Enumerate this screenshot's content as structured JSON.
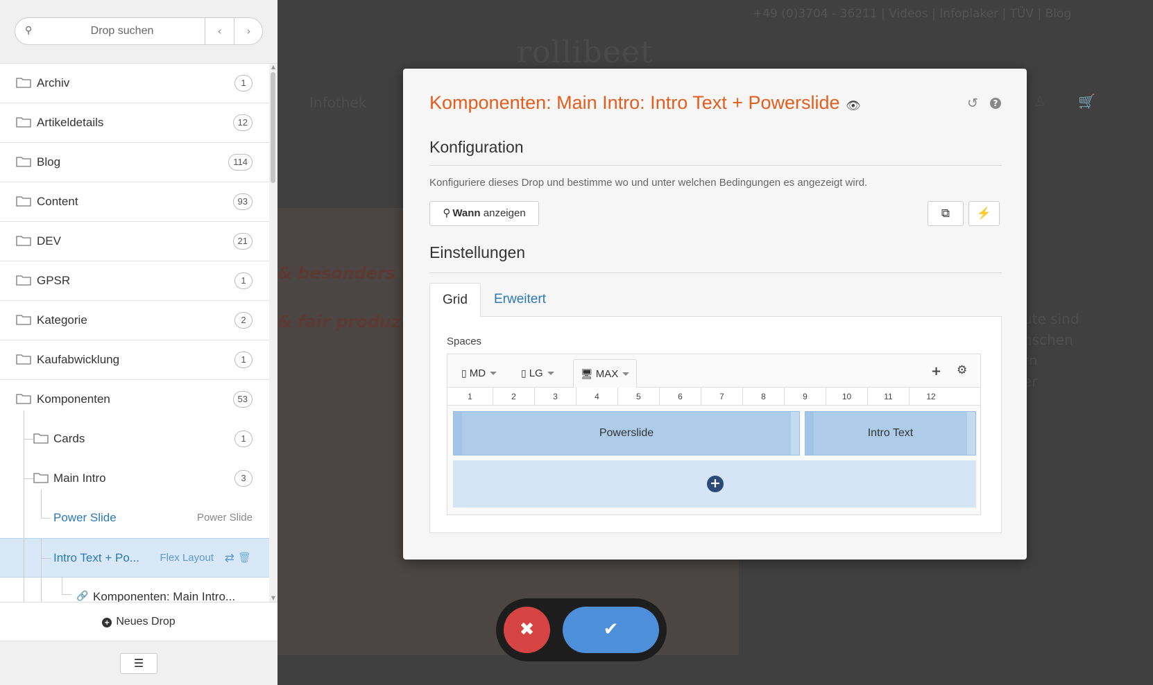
{
  "search": {
    "placeholder": "Drop suchen",
    "prev_glyph": "‹",
    "next_glyph": "›"
  },
  "tree": {
    "folders": [
      {
        "label": "Archiv",
        "count": "1"
      },
      {
        "label": "Artikeldetails",
        "count": "12"
      },
      {
        "label": "Blog",
        "count": "114"
      },
      {
        "label": "Content",
        "count": "93"
      },
      {
        "label": "DEV",
        "count": "21"
      },
      {
        "label": "GPSR",
        "count": "1"
      },
      {
        "label": "Kategorie",
        "count": "2"
      },
      {
        "label": "Kaufabwicklung",
        "count": "1"
      },
      {
        "label": "Komponenten",
        "count": "53"
      }
    ],
    "cards": {
      "label": "Cards",
      "count": "1"
    },
    "main_intro": {
      "label": "Main Intro",
      "count": "3"
    },
    "power_slide": {
      "label": "Power Slide",
      "type": "Power Slide"
    },
    "intro_text": {
      "label": "Intro Text + Po...",
      "type": "Flex Layout"
    },
    "linked": {
      "label": "Komponenten: Main Intro..."
    }
  },
  "new_drop_label": "Neues Drop",
  "modal": {
    "title": "Komponenten: Main Intro: Intro Text + Powerslide",
    "konfiguration": {
      "heading": "Konfiguration",
      "description": "Konfiguriere dieses Drop und bestimme wo und unter welchen Bedingungen es angezeigt wird.",
      "when_button_bold": "Wann",
      "when_button_rest": "anzeigen"
    },
    "einstellungen": {
      "heading": "Einstellungen"
    },
    "tabs": {
      "grid": "Grid",
      "erweitert": "Erweitert"
    },
    "spaces_label": "Spaces",
    "breakpoints": [
      {
        "label": "MD",
        "icon": "mobile-icon"
      },
      {
        "label": "LG",
        "icon": "tablet-icon"
      },
      {
        "label": "MAX",
        "icon": "desktop-icon",
        "active": true
      }
    ],
    "columns": [
      "1",
      "2",
      "3",
      "4",
      "5",
      "6",
      "7",
      "8",
      "9",
      "10",
      "11",
      "12"
    ],
    "grid_items": [
      {
        "label": "Powerslide"
      },
      {
        "label": "Intro Text"
      }
    ]
  },
  "background_site": {
    "topbar": "+49 (0)3704 - 36211",
    "topbar_links": [
      "Videos",
      "Infoplaker",
      "TÜV",
      "Blog"
    ],
    "logo": "rollibeet",
    "nav_item": "Infothek",
    "hero_line_1": "& besonders st",
    "hero_line_2": "& fair produzier",
    "right_lines": [
      "ute sind",
      "nschen",
      "rn",
      "er"
    ]
  },
  "colors": {
    "accent": "#e35d1c",
    "link": "#2a79b4",
    "cancel": "#d64343",
    "confirm": "#4d8fd8",
    "grid_item": "#aecbea"
  }
}
